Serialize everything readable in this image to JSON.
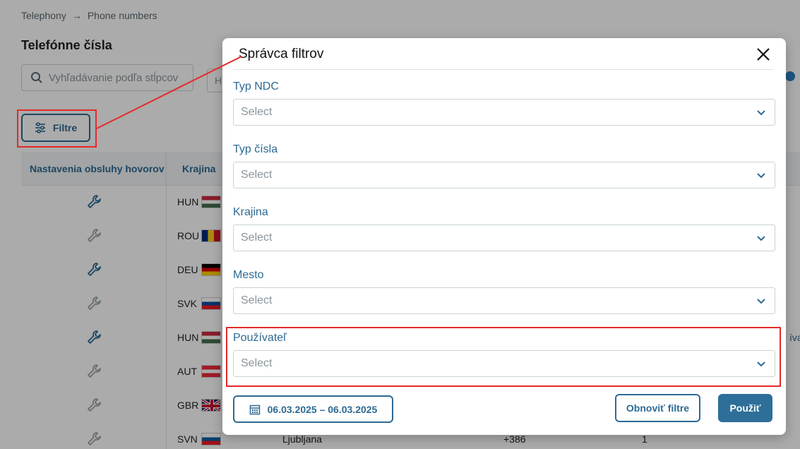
{
  "breadcrumb": {
    "item1": "Telephony",
    "arrow": "→",
    "item2": "Phone numbers"
  },
  "page": {
    "title": "Telefónne čísla",
    "search_placeholder": "Vyhľadávanie podľa stĺpcov",
    "second_input_partial": "H",
    "filter_button_label": "Filtre"
  },
  "table": {
    "headers": [
      "Nastavenia obsluhy hovorov",
      "Krajina"
    ],
    "rows": [
      {
        "code": "HUN",
        "icon": "wrench-icon-active"
      },
      {
        "code": "ROU",
        "icon": "wrench-icon-inactive"
      },
      {
        "code": "DEU",
        "icon": "wrench-icon-active"
      },
      {
        "code": "SVK",
        "icon": "wrench-icon-inactive"
      },
      {
        "code": "HUN",
        "icon": "wrench-icon-active"
      },
      {
        "code": "AUT",
        "icon": "wrench-icon-inactive"
      },
      {
        "code": "GBR",
        "icon": "wrench-icon-inactive"
      },
      {
        "code": "SVN",
        "icon": "wrench-icon-inactive"
      }
    ],
    "last_row_city": "Ljubljana",
    "last_row_phone_prefix": "+386",
    "last_row_count": "1",
    "edge_text": "íva"
  },
  "modal": {
    "title": "Správca filtrov",
    "fields": [
      {
        "label": "Typ NDC",
        "placeholder": "Select"
      },
      {
        "label": "Typ čísla",
        "placeholder": "Select"
      },
      {
        "label": "Krajina",
        "placeholder": "Select"
      },
      {
        "label": "Mesto",
        "placeholder": "Select"
      },
      {
        "label": "Používateľ",
        "placeholder": "Select"
      }
    ],
    "date_range": "06.03.2025 – 06.03.2025",
    "reset_label": "Obnoviť filtre",
    "apply_label": "Použiť"
  },
  "colors": {
    "accent": "#2d6a93",
    "apply_bg": "#2d6f98",
    "annotation": "#e52a2a"
  }
}
